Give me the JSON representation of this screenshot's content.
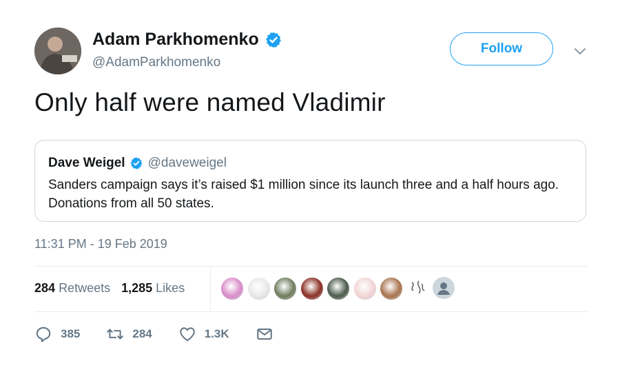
{
  "author": {
    "name": "Adam Parkhomenko",
    "handle": "@AdamParkhomenko"
  },
  "follow_label": "Follow",
  "tweet_text": "Only half were named Vladimir",
  "quoted": {
    "name": "Dave Weigel",
    "handle": "@daveweigel",
    "text": "Sanders campaign says it’s raised $1 million since its launch three and a half hours ago. Donations from all 50 states."
  },
  "timestamp": "11:31 PM - 19 Feb 2019",
  "stats": {
    "retweets_count": "284",
    "retweets_label": "Retweets",
    "likes_count": "1,285",
    "likes_label": "Likes"
  },
  "likers": [
    {
      "icon": "liker-avatar-pink",
      "color": "#d98cc9"
    },
    {
      "icon": "liker-avatar-sketch",
      "color": "#e8e8e8"
    },
    {
      "icon": "liker-avatar-man",
      "color": "#6f7c5d"
    },
    {
      "icon": "liker-avatar-flower",
      "color": "#8a2f24"
    },
    {
      "icon": "liker-avatar-landscape",
      "color": "#4a5a4a"
    },
    {
      "icon": "liker-avatar-seal",
      "color": "#f2d4d4"
    },
    {
      "icon": "liker-avatar-woman",
      "color": "#a8734d"
    },
    {
      "icon": "liker-avatar-signature",
      "color": "#ffffff"
    },
    {
      "icon": "liker-avatar-default",
      "color": "#ccd6dd"
    }
  ],
  "actions": {
    "reply_count": "385",
    "retweet_count": "284",
    "like_count": "1.3K"
  },
  "colors": {
    "accent": "#1da1f2",
    "secondary_text": "#657786",
    "border": "#e6ecf0"
  }
}
